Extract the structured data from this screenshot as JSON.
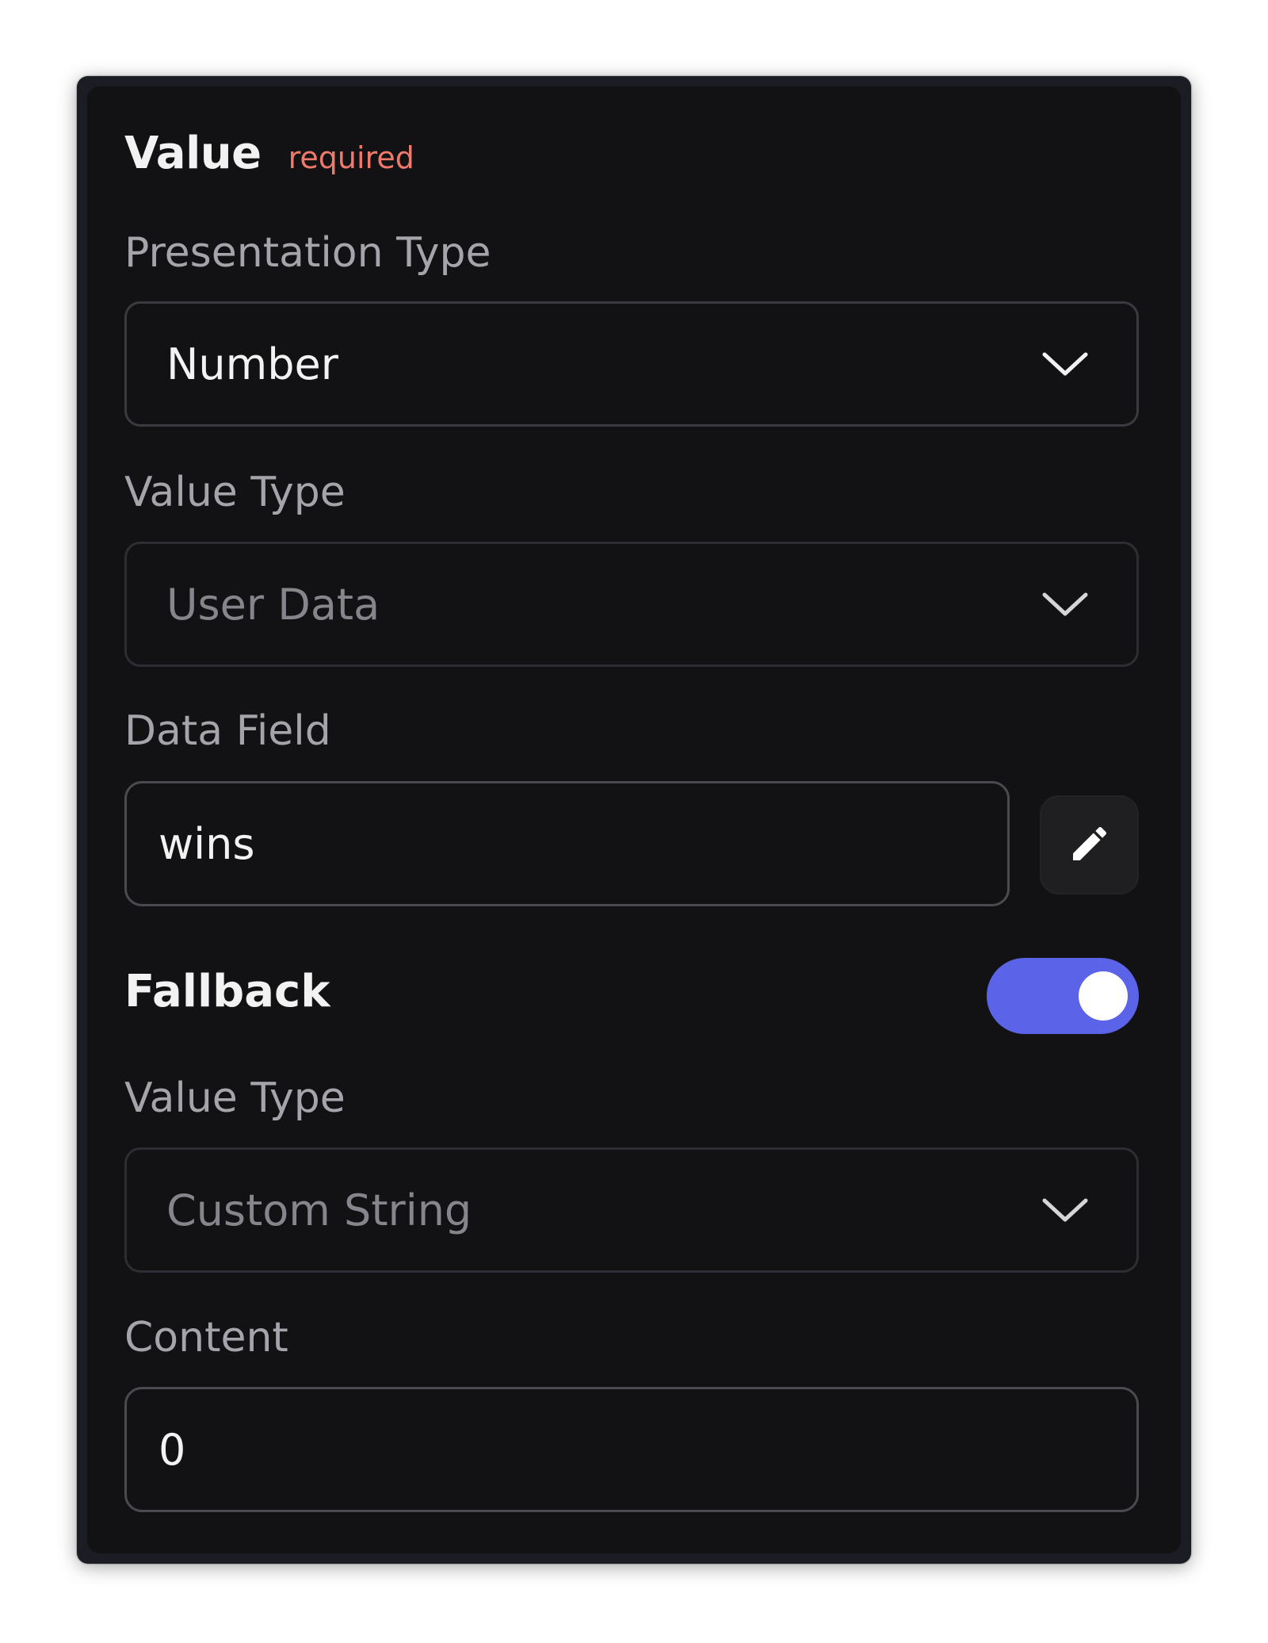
{
  "section": {
    "title": "Value",
    "required_label": "required"
  },
  "presentation_type": {
    "label": "Presentation Type",
    "selected": "Number"
  },
  "value_type": {
    "label": "Value Type",
    "selected": "User Data"
  },
  "data_field": {
    "label": "Data Field",
    "value": "wins"
  },
  "fallback": {
    "label": "Fallback",
    "enabled": true,
    "value_type_label": "Value Type",
    "value_type_selected": "Custom String",
    "content_label": "Content",
    "content_value": "0"
  },
  "colors": {
    "accent": "#5b63e8",
    "required": "#ef7a6c",
    "panel_bg": "#121214"
  },
  "icons": {
    "dropdown": "chevron-down-icon",
    "edit": "pencil-icon"
  }
}
